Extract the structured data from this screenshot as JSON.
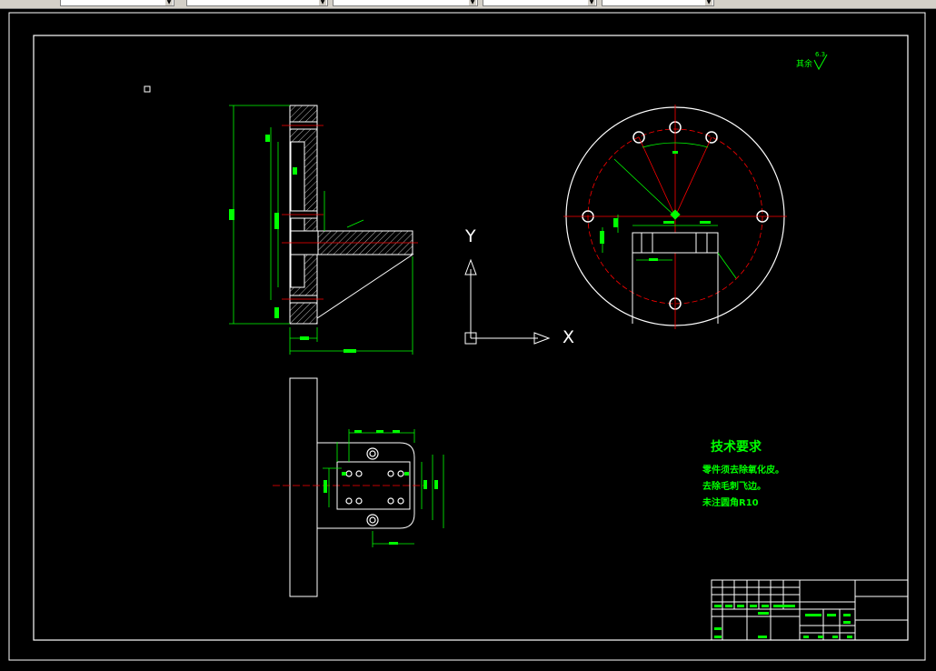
{
  "toolbar": {
    "fields": [
      {
        "value": "",
        "selected": false
      },
      {
        "value": "",
        "selected": false
      },
      {
        "value": "",
        "selected": false
      },
      {
        "value": "",
        "selected": false
      },
      {
        "value": "",
        "selected": false
      }
    ]
  },
  "drawing": {
    "tech_requirements_title": "技术要求",
    "tech_requirements": [
      "零件须去除氧化皮。",
      "去除毛刺飞边。",
      "未注圆角R10"
    ],
    "surface_finish_note": "其余",
    "surface_finish_value": "6.3",
    "ucs_y_label": "Y",
    "ucs_x_label": "X"
  },
  "colors": {
    "background": "#000000",
    "lines": "#ffffff",
    "dimensions": "#00ff00",
    "centerlines": "#ff0000",
    "text": "#00ff00"
  }
}
